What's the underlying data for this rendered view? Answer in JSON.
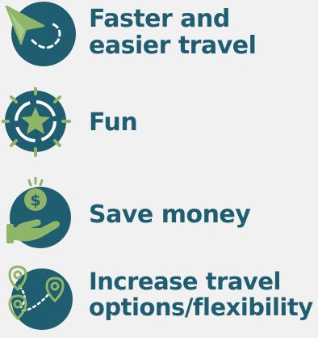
{
  "colors": {
    "background": "#f2f1f1",
    "circle": "#1f5d70",
    "accent": "#8fb569",
    "text": "#1f5d70",
    "white": "#ffffff"
  },
  "items": [
    {
      "icon": "paper-plane-icon",
      "lines": [
        "Faster and",
        "easier travel"
      ]
    },
    {
      "icon": "star-icon",
      "lines": [
        "Fun"
      ]
    },
    {
      "icon": "money-hand-icon",
      "lines": [
        "Save money"
      ]
    },
    {
      "icon": "map-pins-route-icon",
      "lines": [
        "Increase travel",
        "options/flexibility"
      ]
    }
  ]
}
